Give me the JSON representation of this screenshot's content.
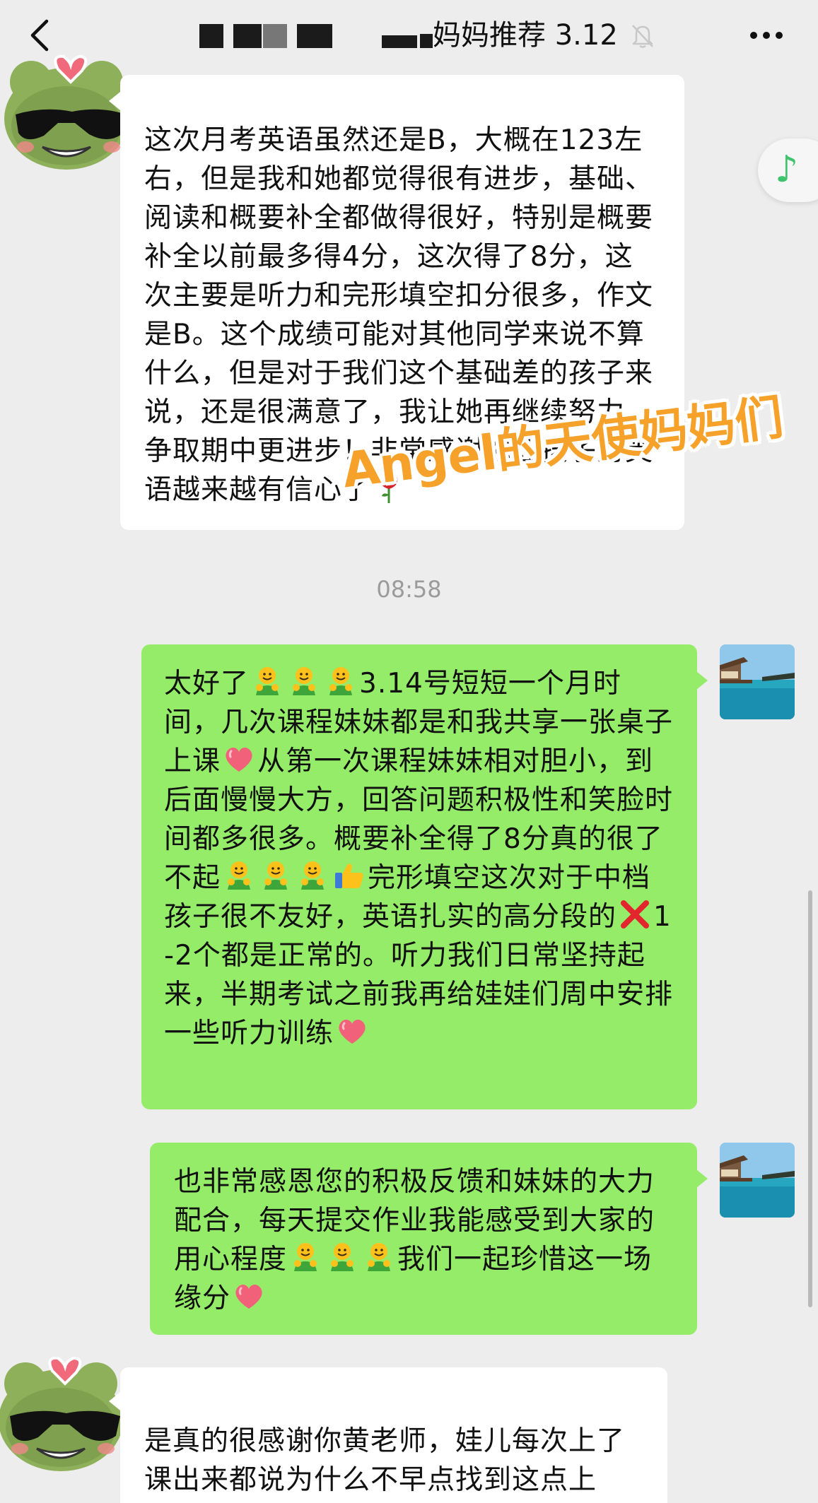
{
  "header": {
    "title_visible": "妈妈推荐 3.12",
    "back_icon": "chevron-left-icon",
    "mute_icon": "bell-off-icon",
    "more_icon": "ellipsis-icon"
  },
  "watermark": {
    "text": "Angel的天使妈妈们",
    "color": "#f5a12a"
  },
  "timestamp": "08:58",
  "messages": [
    {
      "side": "incoming",
      "text": "这次月考英语虽然还是B，大概在123左右，但是我和她都觉得很有进步，基础、阅读和概要补全都做得很好，特别是概要补全以前最多得4分，这次得了8分，这次主要是听力和完形填空扣分很多，作文是B。这个成绩可能对其他同学来说不算什么，但是对于我们这个基础差的孩子来说，还是很满意了，我让她再继续努力，争取期中更进步！非常感谢你让孩子对英语越来越有信心了",
      "emoji_end": "rose"
    },
    {
      "side": "outgoing",
      "segments": [
        "太好了",
        "3.14号短短一个月时间，几次课程妹妹都是和我共享一张桌子上课",
        "从第一次课程妹妹相对胆小，到后面慢慢大方，回答问题积极性和笑脸时间都多很多。概要补全得了8分真的很了不起",
        "完形填空这次对于中档孩子很不友好，英语扎实的高分段的",
        "1-2个都是正常的。听力我们日常坚持起来，半期考试之前我再给娃娃们周中安排一些听力训练"
      ]
    },
    {
      "side": "outgoing",
      "segments": [
        "也非常感恩您的积极反馈和妹妹的大力配合，每天提交作业我能感受到大家的用心程度",
        "我们一起珍惜这一场缘分"
      ]
    },
    {
      "side": "incoming",
      "text": "是真的很感谢你黄老师，娃儿每次上了课出来都说为什么不早点找到这点上课，要不然英语早就提上去了"
    }
  ],
  "colors": {
    "background": "#ededed",
    "incoming_bubble": "#ffffff",
    "outgoing_bubble": "#95ec69",
    "timestamp": "#9b9b9b"
  },
  "icons": {
    "music": "music-note-icon"
  },
  "music_note": "♪"
}
